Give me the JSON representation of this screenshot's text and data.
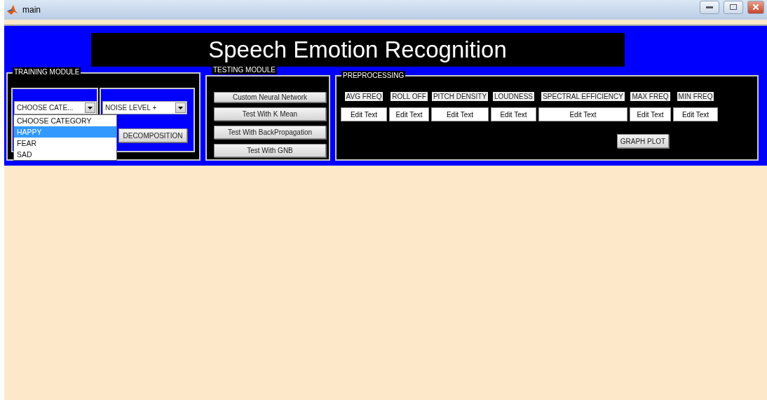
{
  "window": {
    "title": "main"
  },
  "heading": "Speech Emotion Recognition",
  "training": {
    "title": "TRAINING MODULE",
    "category": {
      "value": "CHOOSE CATE...",
      "expanded": true,
      "options": [
        {
          "label": "CHOOSE CATEGORY",
          "selected": false
        },
        {
          "label": "HAPPY",
          "selected": true
        },
        {
          "label": "FEAR",
          "selected": false
        },
        {
          "label": "SAD",
          "selected": false
        }
      ]
    },
    "noise": {
      "value": "NOISE LEVEL +"
    },
    "decomposition": "DECOMPOSITION"
  },
  "testing": {
    "title": "TESTING MODULE",
    "buttons": [
      "Custom Neural Network",
      "Test With  K Mean",
      "Test With BackPropagation",
      "Test With GNB"
    ]
  },
  "preprocessing": {
    "title": "PREPROCESSING",
    "features": [
      {
        "label": "AVG FREQ",
        "value": "Edit Text"
      },
      {
        "label": "ROLL OFF",
        "value": "Edit Text"
      },
      {
        "label": "PITCH DENSITY",
        "value": "Edit Text"
      },
      {
        "label": "LOUDNESS",
        "value": "Edit Text"
      },
      {
        "label": "SPECTRAL EFFICIENCY",
        "value": "Edit Text"
      },
      {
        "label": "MAX FREQ",
        "value": "Edit Text"
      },
      {
        "label": "MIN FREQ",
        "value": "Edit Text"
      }
    ],
    "graph_button": "GRAPH PLOT"
  }
}
